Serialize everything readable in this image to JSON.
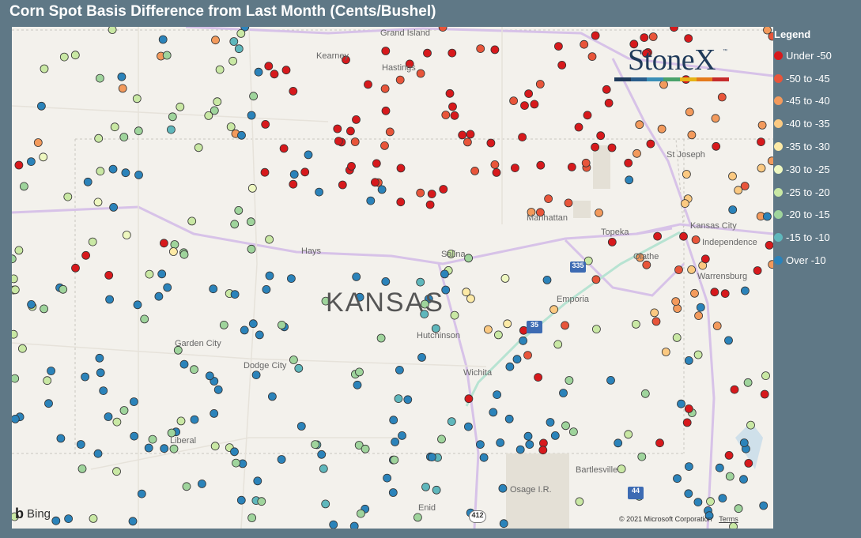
{
  "title": "Corn Spot Basis Difference from Last Month (Cents/Bushel)",
  "legend": {
    "title": "Legend",
    "items": [
      {
        "label": "Under -50",
        "color": "#d7191c"
      },
      {
        "label": "-50 to -45",
        "color": "#e8553a"
      },
      {
        "label": "-45 to -40",
        "color": "#f39a5c"
      },
      {
        "label": "-40 to -35",
        "color": "#fbc981"
      },
      {
        "label": "-35 to -30",
        "color": "#fdeaa6"
      },
      {
        "label": "-30 to -25",
        "color": "#eef7c0"
      },
      {
        "label": "-25 to -20",
        "color": "#c9e8a4"
      },
      {
        "label": "-20 to -15",
        "color": "#9fd49c"
      },
      {
        "label": "-15 to -10",
        "color": "#5fb7bc"
      },
      {
        "label": "Over -10",
        "color": "#2b83ba"
      }
    ]
  },
  "brand": {
    "name": "StoneX",
    "tm": "™"
  },
  "map": {
    "state_label": "KANSAS",
    "cities": [
      "Grand Island",
      "Kearney",
      "Hastings",
      "St Joseph",
      "Manhattan",
      "Topeka",
      "Kansas City",
      "Independence",
      "Olathe",
      "Hays",
      "Salina",
      "Emporia",
      "Warrensburg",
      "Garden City",
      "Dodge City",
      "Hutchinson",
      "Wichita",
      "Liberal",
      "Bartlesville",
      "Osage I.R.",
      "Enid"
    ],
    "highways": [
      "335",
      "35",
      "44",
      "412"
    ],
    "attribution": {
      "bing": "Bing",
      "copyright": "© 2021 Microsoft Corporation",
      "terms": "Terms"
    }
  }
}
